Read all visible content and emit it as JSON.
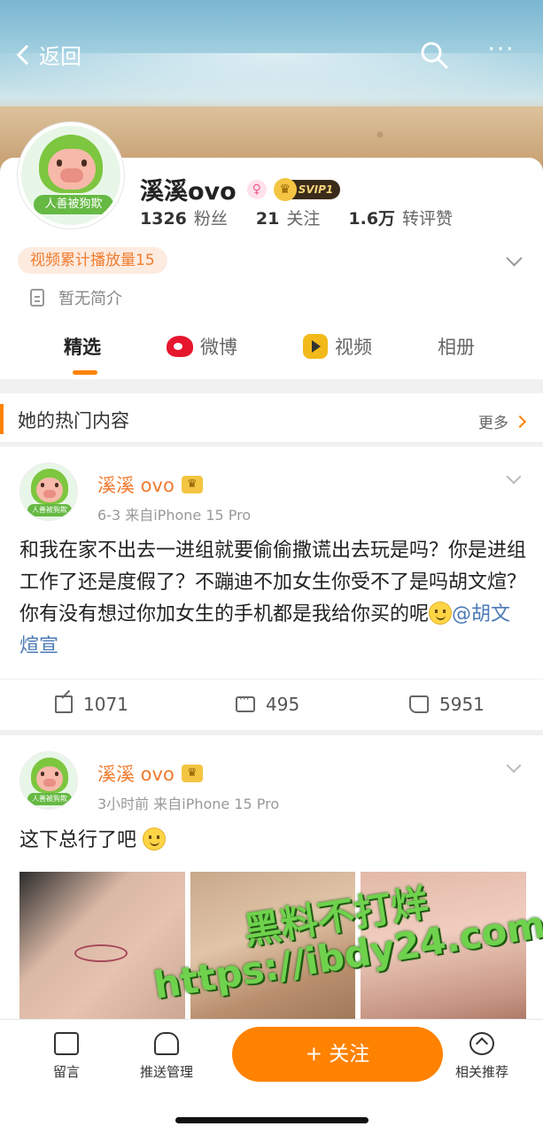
{
  "nav": {
    "back_label": "返回",
    "more_label": "···"
  },
  "profile": {
    "avatar_tag": "人善被狗欺",
    "name": "溪溪ovo",
    "gender_symbol": "♀",
    "vip_badge": "SVIP1",
    "stats": [
      {
        "value": "1326",
        "label": "粉丝"
      },
      {
        "value": "21",
        "label": "关注"
      },
      {
        "value": "1.6万",
        "label": "转评赞"
      }
    ],
    "play_badge": "视频累计播放量15",
    "bio": "暂无简介"
  },
  "tabs": [
    {
      "label": "精选",
      "active": true
    },
    {
      "label": "微博",
      "active": false
    },
    {
      "label": "视频",
      "active": false
    },
    {
      "label": "相册",
      "active": false
    }
  ],
  "hot_section": {
    "title": "她的热门内容",
    "more_label": "更多"
  },
  "posts": [
    {
      "avatar_tag": "人善被狗欺",
      "author": "溪溪 ovo",
      "meta": "6-3   来自iPhone 15 Pro",
      "text": "和我在家不出去一进组就要偷偷撒谎出去玩是吗？你是进组工作了还是度假了？不蹦迪不加女生你受不了是吗胡文煊？你有没有想过你加女生的手机都是我给你买的呢",
      "mention": "@胡文煊宣",
      "reposts": "1071",
      "comments": "495",
      "likes": "5951"
    },
    {
      "avatar_tag": "人善被狗欺",
      "author": "溪溪 ovo",
      "meta": "3小时前   来自iPhone 15 Pro",
      "text": "这下总行了吧"
    }
  ],
  "watermark": {
    "line1": "黑料不打烊",
    "line2": "https://ibdy24.com"
  },
  "bottom_bar": {
    "message_label": "留言",
    "push_label": "推送管理",
    "follow_label": "+ 关注",
    "recommend_label": "相关推荐"
  },
  "colors": {
    "accent": "#ff8200",
    "author": "#f07b2d",
    "mention": "#4a7ab5"
  }
}
